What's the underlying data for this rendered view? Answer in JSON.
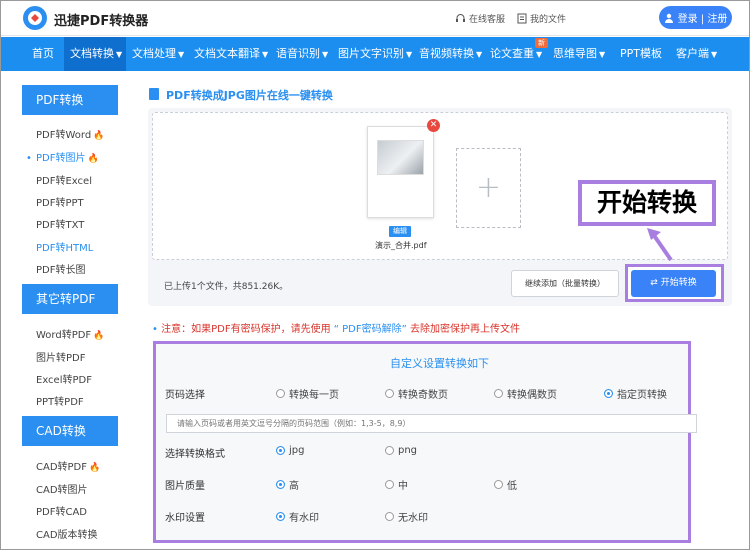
{
  "header": {
    "brand": "迅捷PDF转换器",
    "service": "在线客服",
    "files": "我的文件",
    "login": "登录 | 注册"
  },
  "nav": {
    "items": [
      "首页",
      "文档转换",
      "文档处理",
      "文档文本翻译",
      "语音识别",
      "图片文字识别",
      "音视频转换",
      "论文查重",
      "思维导图",
      "PPT模板",
      "客户端"
    ],
    "new_badge": "新"
  },
  "sidebar": {
    "groups": [
      {
        "title": "PDF转换",
        "items": [
          "PDF转Word",
          "PDF转图片",
          "PDF转Excel",
          "PDF转PPT",
          "PDF转TXT",
          "PDF转HTML",
          "PDF转长图"
        ]
      },
      {
        "title": "其它转PDF",
        "items": [
          "Word转PDF",
          "图片转PDF",
          "Excel转PDF",
          "PPT转PDF"
        ]
      },
      {
        "title": "CAD转换",
        "items": [
          "CAD转PDF",
          "CAD转图片",
          "PDF转CAD",
          "CAD版本转换"
        ]
      }
    ]
  },
  "main": {
    "title": "PDF转换成JPG图片在线一键转换",
    "file_name": "演示_合并.pdf",
    "edit_label": "编辑",
    "upload_info": "已上传1个文件，共851.26K。",
    "continue_label": "继续添加（批量转换）",
    "start_label": "开始转换",
    "callout": "开始转换",
    "notice_prefix": "注意：如果PDF有密码保护，请先使用",
    "notice_link": "“ PDF密码解除”",
    "notice_suffix": "去除加密保护再上传文件"
  },
  "settings": {
    "title": "自定义设置转换如下",
    "page_label": "页码选择",
    "page_options": [
      "转换每一页",
      "转换奇数页",
      "转换偶数页",
      "指定页转换"
    ],
    "range_placeholder": "请输入页码或者用英文逗号分隔的页码范围（例如：1,3-5，8,9）",
    "format_label": "选择转换格式",
    "format_options": [
      "jpg",
      "png"
    ],
    "quality_label": "图片质量",
    "quality_options": [
      "高",
      "中",
      "低"
    ],
    "watermark_label": "水印设置",
    "watermark_options": [
      "有水印",
      "无水印"
    ]
  },
  "colors": {
    "accent": "#1c8ef0",
    "highlight": "#a87fe0",
    "warning": "#d9342b"
  }
}
